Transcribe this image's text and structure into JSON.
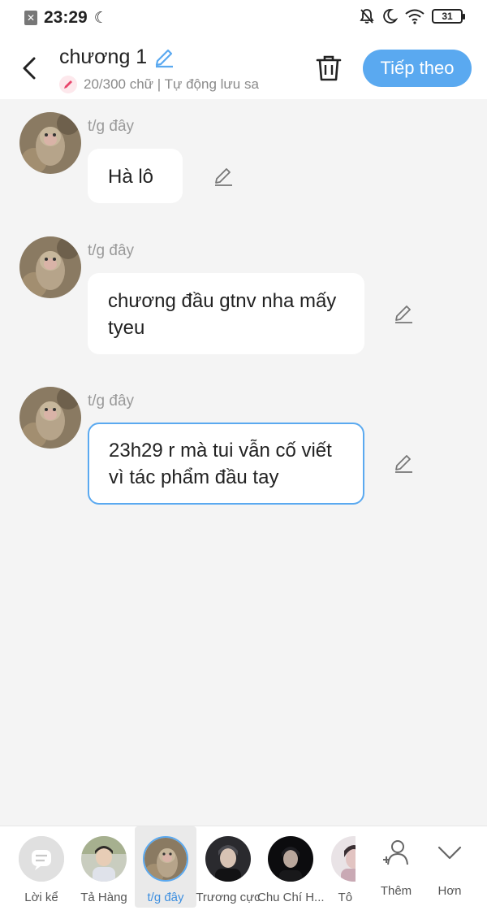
{
  "status_bar": {
    "time": "23:29",
    "battery": "31"
  },
  "header": {
    "title": "chương 1",
    "subtitle": "20/300 chữ | Tự động lưu sa",
    "next_button": "Tiếp theo"
  },
  "messages": [
    {
      "sender": "t/g đây",
      "text": "Hà lô"
    },
    {
      "sender": "t/g đây",
      "text": "chương đầu gtnv nha mấy tyeu"
    },
    {
      "sender": "t/g đây",
      "text": "23h29 r mà tui vẫn cố viết vì tác phẩm đầu tay"
    }
  ],
  "characters": [
    {
      "name": "Lời kể"
    },
    {
      "name": "Tả Hàng"
    },
    {
      "name": "t/g đây",
      "selected": true
    },
    {
      "name": "Trương cực"
    },
    {
      "name": "Chu Chí H..."
    },
    {
      "name": "Tô Tâ"
    }
  ],
  "actions": {
    "add": "Thêm",
    "more": "Hơn"
  },
  "colors": {
    "accent": "#5aa9f0",
    "background": "#f4f4f4",
    "bubble": "#ffffff"
  }
}
